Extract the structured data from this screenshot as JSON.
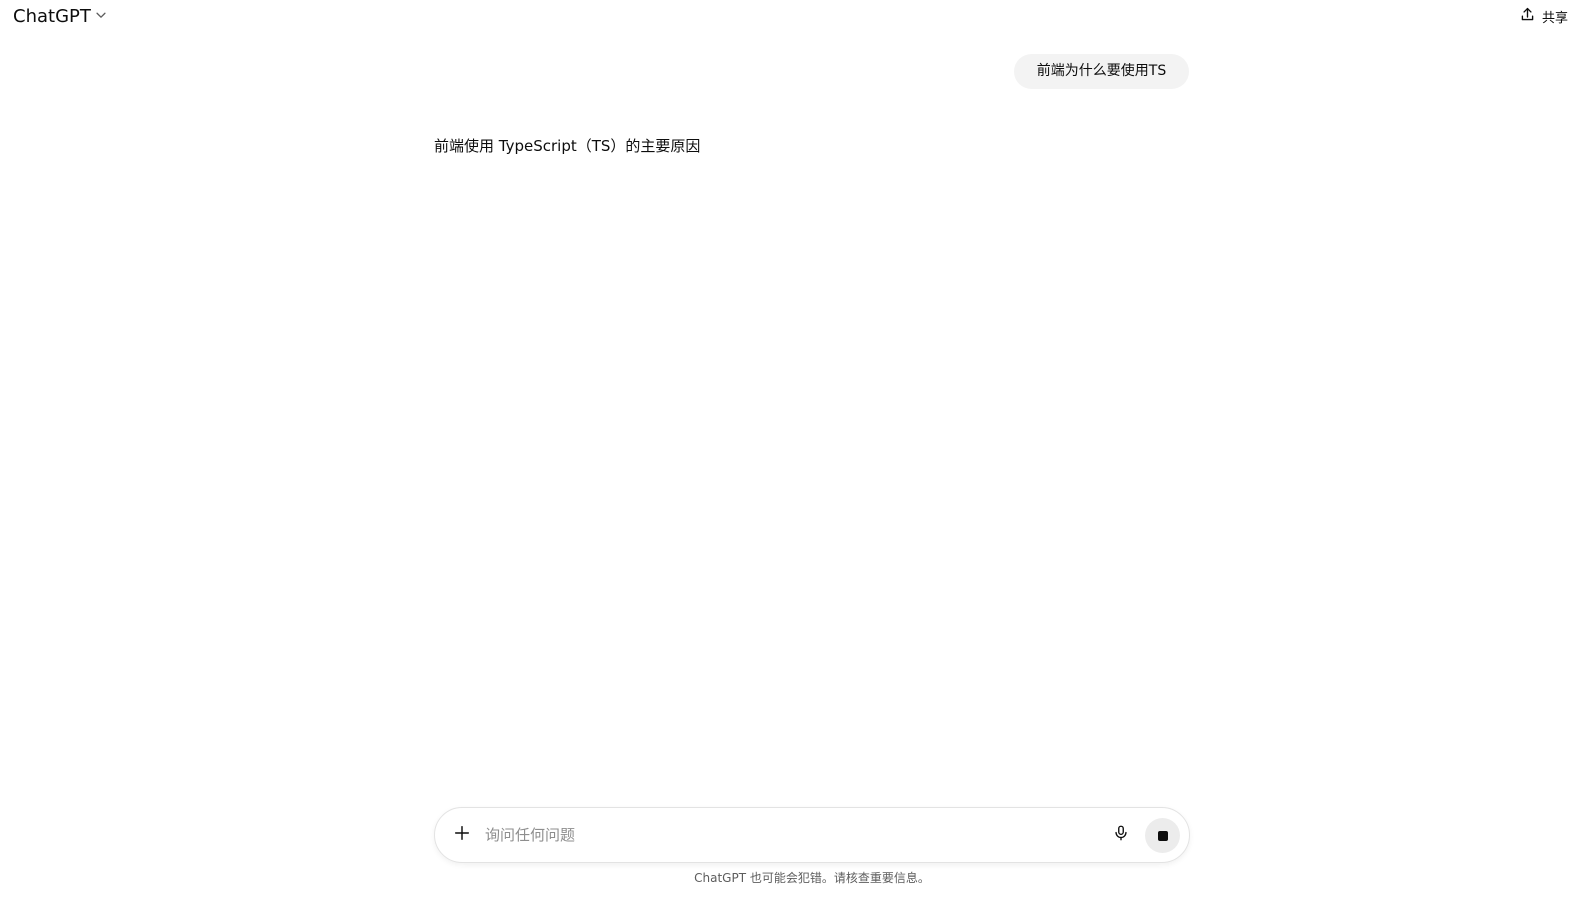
{
  "header": {
    "title": "ChatGPT",
    "title_dropdown_icon": "chevron-down-icon",
    "share_label": "共享",
    "share_icon": "share-icon"
  },
  "conversation": {
    "user_message": "前端为什么要使用TS",
    "assistant_message": "前端使用 TypeScript（TS）的主要原因"
  },
  "composer": {
    "placeholder": "询问任何问题",
    "value": "",
    "attach_icon": "plus-icon",
    "voice_icon": "microphone-icon",
    "stop_icon": "stop-icon"
  },
  "footer": {
    "disclaimer": "ChatGPT 也可能会犯错。请核查重要信息。"
  }
}
